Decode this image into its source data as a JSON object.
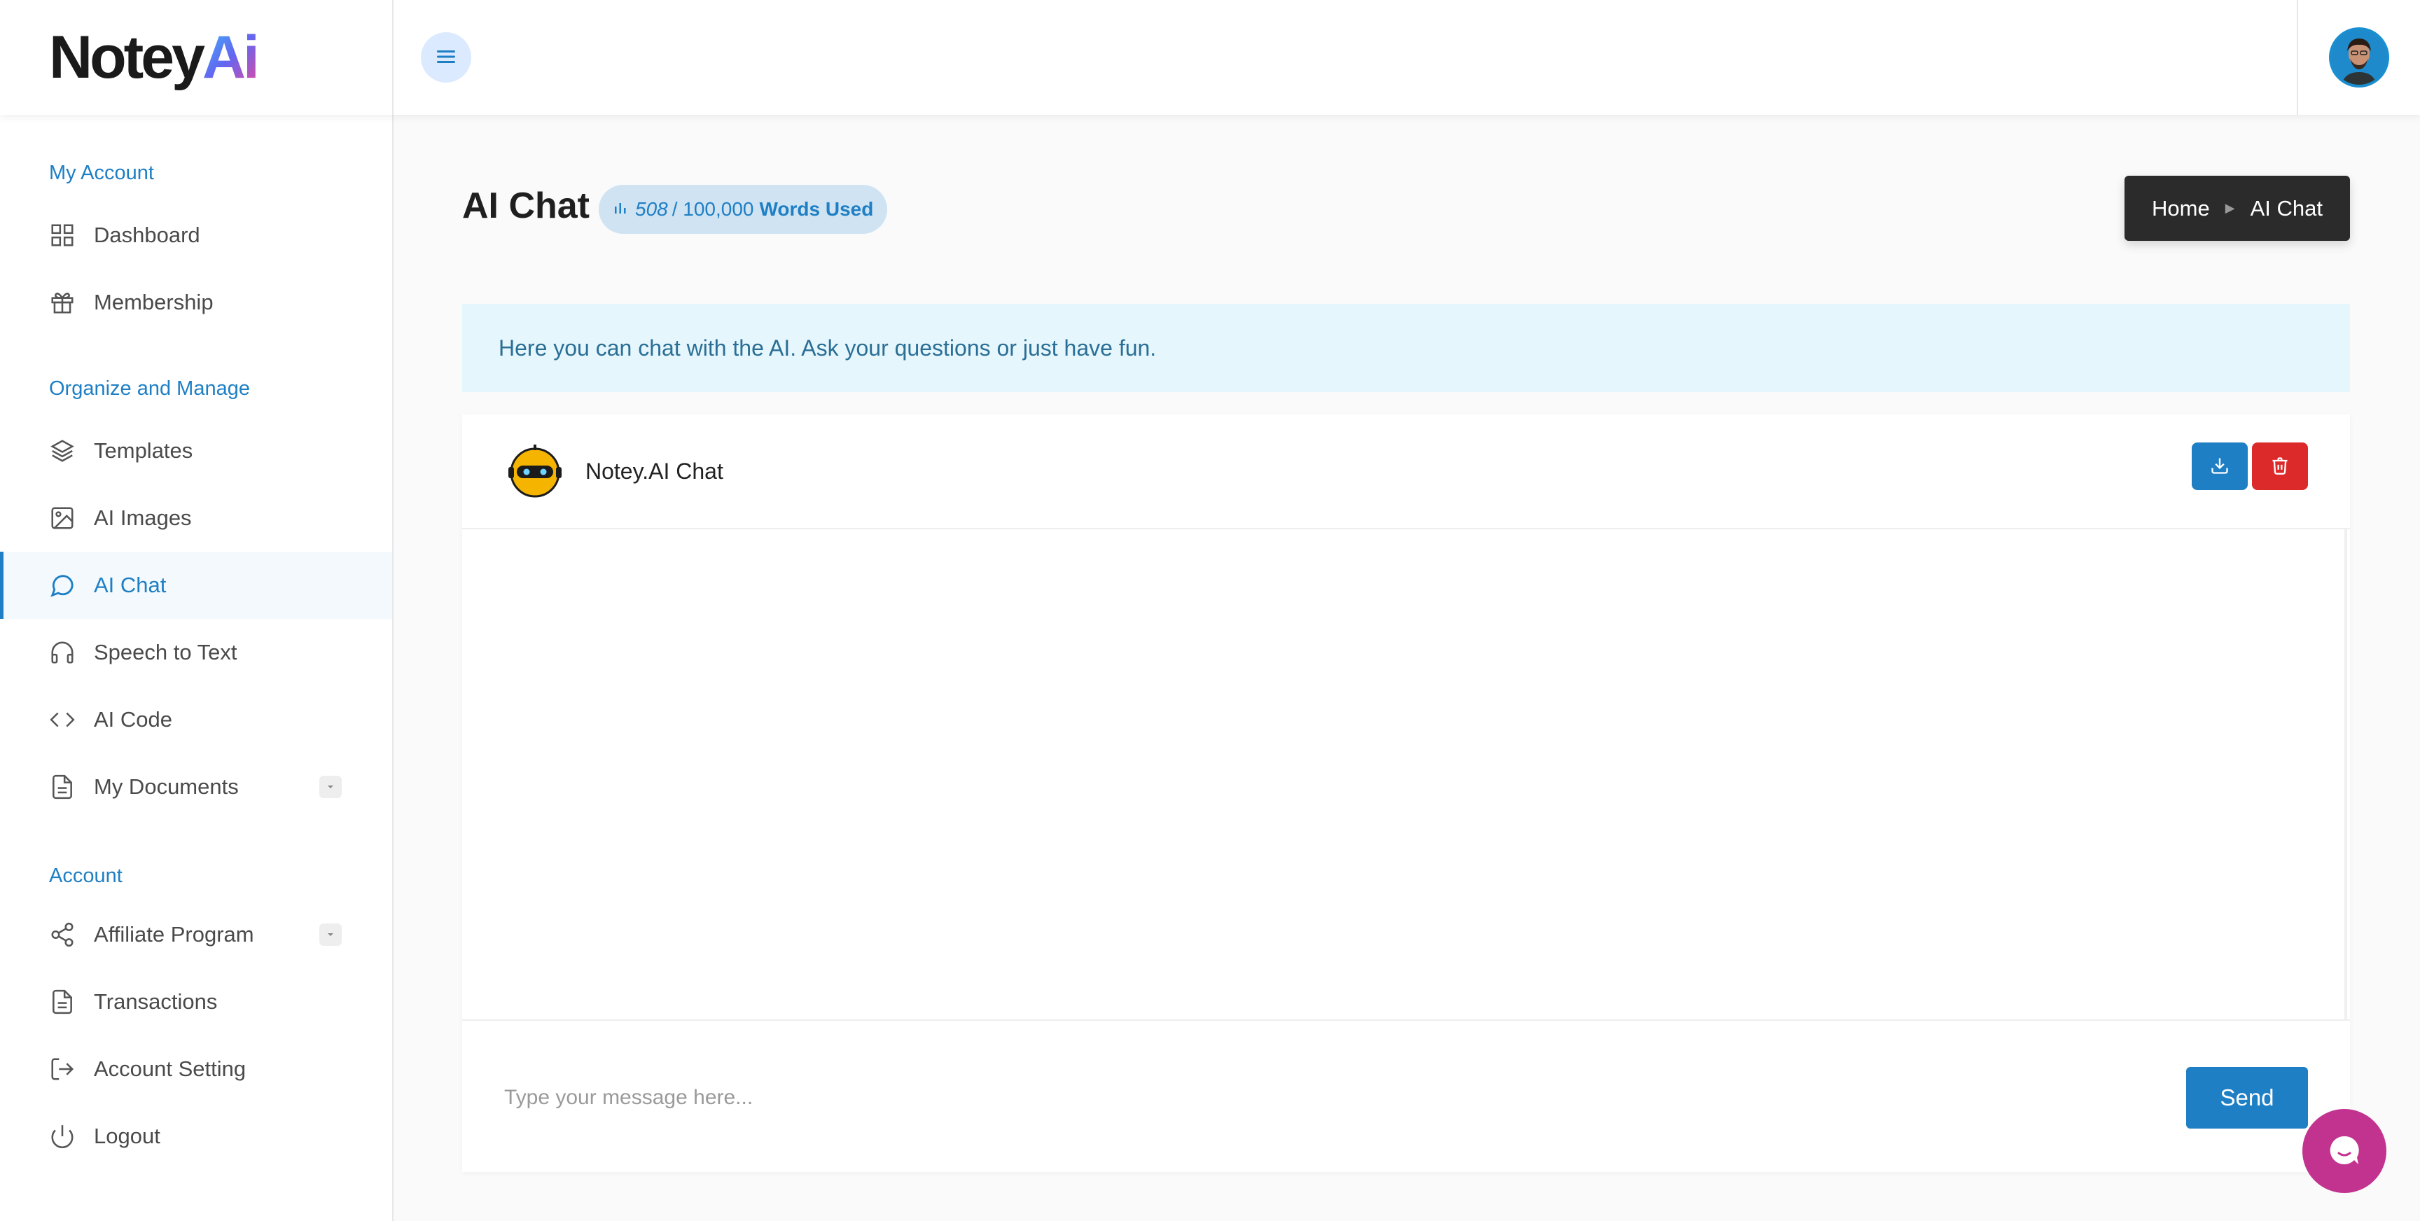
{
  "brand": {
    "logo_text": "Notey",
    "logo_accent": "Ai"
  },
  "header": {
    "menu_icon": "hamburger-icon",
    "avatar": "user-avatar"
  },
  "sidebar": {
    "sections": [
      {
        "label": "My Account",
        "items": [
          {
            "label": "Dashboard",
            "icon": "grid-icon"
          },
          {
            "label": "Membership",
            "icon": "gift-icon"
          }
        ]
      },
      {
        "label": "Organize and Manage",
        "items": [
          {
            "label": "Templates",
            "icon": "layers-icon"
          },
          {
            "label": "AI Images",
            "icon": "image-icon"
          },
          {
            "label": "AI Chat",
            "icon": "message-circle-icon",
            "active": true
          },
          {
            "label": "Speech to Text",
            "icon": "headphones-icon"
          },
          {
            "label": "AI Code",
            "icon": "code-icon"
          },
          {
            "label": "My Documents",
            "icon": "file-icon",
            "has_dropdown": true
          }
        ]
      },
      {
        "label": "Account",
        "items": [
          {
            "label": "Affiliate Program",
            "icon": "share-icon",
            "has_dropdown": true
          },
          {
            "label": "Transactions",
            "icon": "file-icon"
          },
          {
            "label": "Account Setting",
            "icon": "log-in-icon"
          },
          {
            "label": "Logout",
            "icon": "power-icon"
          }
        ]
      }
    ]
  },
  "page": {
    "title": "AI Chat",
    "usage": {
      "used": "508",
      "limit": "/ 100,000",
      "suffix": "Words Used"
    },
    "breadcrumb": {
      "home": "Home",
      "current": "AI Chat"
    },
    "info": "Here you can chat with the AI. Ask your questions or just have fun."
  },
  "chat": {
    "name": "Notey.AI Chat",
    "input_placeholder": "Type your message here...",
    "send_label": "Send"
  },
  "colors": {
    "accent": "#1e7fc4",
    "danger": "#dc2a2a",
    "banner": "#e6f6fd",
    "support": "#c2338f"
  }
}
